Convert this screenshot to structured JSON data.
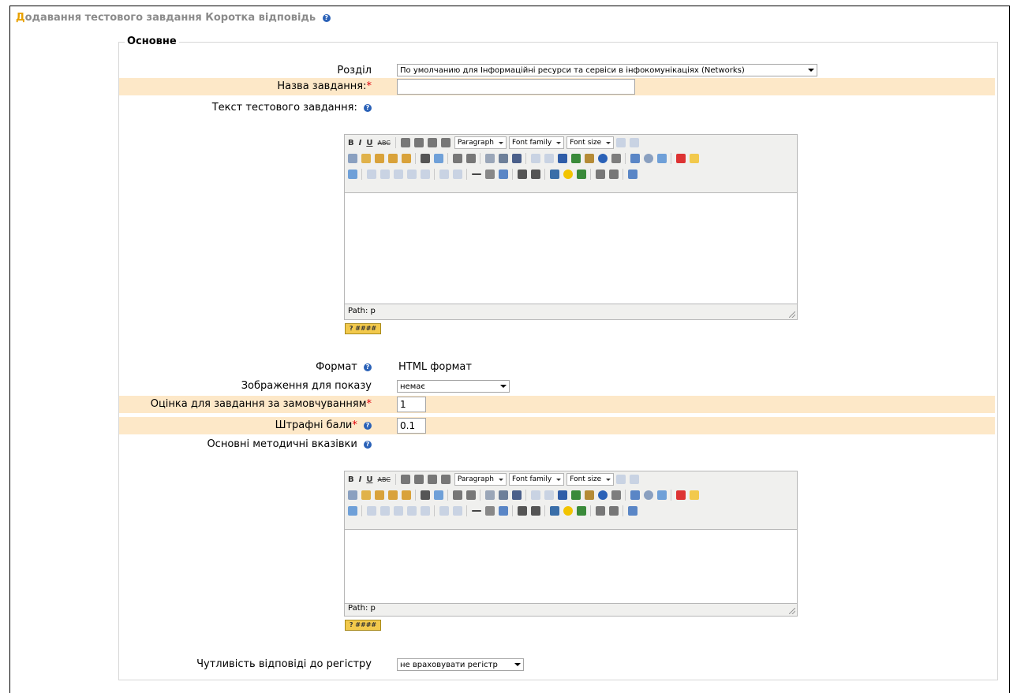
{
  "page": {
    "heading_first": "Д",
    "heading_rest": "одавання тестового завдання Коротка відповідь",
    "help_glyph": "?"
  },
  "fieldset": {
    "legend": "Основне"
  },
  "form": {
    "section_label": "Розділ",
    "section_value": "По умолчанию для Інформаційні ресурси та сервіси в інфокомунікаціях (Networks)",
    "name_label": "Назва завдання:",
    "name_value": "",
    "text_label": "Текст тестового завдання:",
    "format_label": "Формат",
    "format_value": "HTML формат",
    "image_label": "Зображення для показу",
    "image_value": "немає",
    "grade_label": "Оцінка для завдання за замовчуванням",
    "grade_value": "1",
    "penalty_label": "Штрафні бали",
    "penalty_value": "0.1",
    "feedback_label": "Основні методичні вказівки",
    "case_label": "Чутливість відповіді до регістру",
    "case_value": "не враховувати регістр",
    "required_star": "*"
  },
  "editor": {
    "bold": "B",
    "italic": "I",
    "underline": "U",
    "strike": "ABC",
    "format_select": "Paragraph",
    "font_family_select": "Font family",
    "font_size_select": "Font size",
    "path_text": "Path: p",
    "help_badge": "? ####"
  },
  "colors": {
    "accent": "#e8a100",
    "required_bg": "#fde8c8",
    "help_icon": "#2a61b7"
  }
}
